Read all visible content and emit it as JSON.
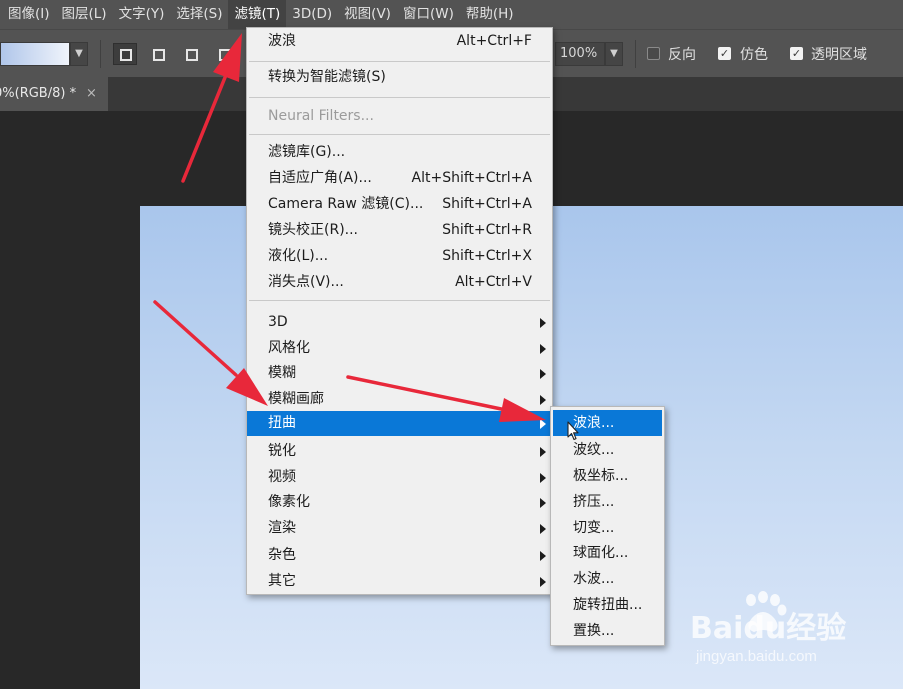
{
  "menubar": {
    "items": [
      {
        "label": "图像(I)"
      },
      {
        "label": "图层(L)"
      },
      {
        "label": "文字(Y)"
      },
      {
        "label": "选择(S)"
      },
      {
        "label": "滤镜(T)"
      },
      {
        "label": "3D(D)"
      },
      {
        "label": "视图(V)"
      },
      {
        "label": "窗口(W)"
      },
      {
        "label": "帮助(H)"
      }
    ]
  },
  "options": {
    "opacity": "100%",
    "reverse_label": "反向",
    "dither_label": "仿色",
    "transparency_label": "透明区域"
  },
  "tab": {
    "title": "0%(RGB/8) *",
    "close": "×"
  },
  "filter_menu": {
    "wave_label": "波浪",
    "wave_shortcut": "Alt+Ctrl+F",
    "smart_label": "转换为智能滤镜(S)",
    "neural_label": "Neural Filters...",
    "gallery_label": "滤镜库(G)...",
    "adaptive_label": "自适应广角(A)...",
    "adaptive_shortcut": "Alt+Shift+Ctrl+A",
    "camera_label": "Camera Raw 滤镜(C)...",
    "camera_shortcut": "Shift+Ctrl+A",
    "lens_label": "镜头校正(R)...",
    "lens_shortcut": "Shift+Ctrl+R",
    "liquify_label": "液化(L)...",
    "liquify_shortcut": "Shift+Ctrl+X",
    "vanish_label": "消失点(V)...",
    "vanish_shortcut": "Alt+Ctrl+V",
    "sub_3d": "3D",
    "sub_stylize": "风格化",
    "sub_blur": "模糊",
    "sub_blur_gallery": "模糊画廊",
    "sub_distort": "扭曲",
    "sub_sharpen": "锐化",
    "sub_video": "视频",
    "sub_pixelate": "像素化",
    "sub_render": "渲染",
    "sub_noise": "杂色",
    "sub_other": "其它"
  },
  "distort_submenu": {
    "items": [
      {
        "label": "波浪..."
      },
      {
        "label": "波纹..."
      },
      {
        "label": "极坐标..."
      },
      {
        "label": "挤压..."
      },
      {
        "label": "切变..."
      },
      {
        "label": "球面化..."
      },
      {
        "label": "水波..."
      },
      {
        "label": "旋转扭曲..."
      },
      {
        "label": "置换..."
      }
    ]
  },
  "watermark": {
    "brand": "Baidu经验",
    "url": "jingyan.baidu.com"
  },
  "colors": {
    "highlight": "#0a78d7",
    "arrow": "#e8283a"
  }
}
